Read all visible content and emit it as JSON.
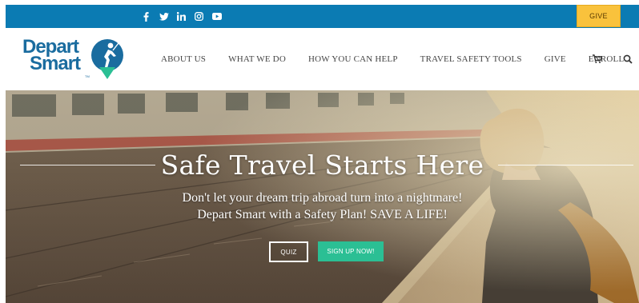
{
  "topbar": {
    "social": [
      {
        "icon": "facebook-icon"
      },
      {
        "icon": "twitter-icon"
      },
      {
        "icon": "linkedin-icon"
      },
      {
        "icon": "instagram-icon"
      },
      {
        "icon": "youtube-icon"
      }
    ],
    "give_label": "GIVE"
  },
  "logo": {
    "line1": "Depart",
    "line2": "Smart",
    "tm": "TM"
  },
  "nav": {
    "items": [
      "ABOUT US",
      "WHAT WE DO",
      "HOW YOU CAN HELP",
      "TRAVEL SAFETY TOOLS",
      "GIVE",
      "ENROLL"
    ],
    "cart_icon": "cart-icon",
    "search_icon": "search-icon"
  },
  "hero": {
    "title": "Safe Travel Starts Here",
    "subtitle_line1": "Don't let your dream trip abroad turn into a nightmare!",
    "subtitle_line2": "Depart Smart with a Safety Plan! SAVE A LIFE!",
    "quiz_label": "QUIZ",
    "signup_label": "SIGN UP NOW!"
  },
  "colors": {
    "topbar": "#0b7bb3",
    "give_button": "#f9c23c",
    "brand_blue": "#1a6c9f",
    "brand_green": "#2bbf94",
    "nav_text": "#444444"
  }
}
